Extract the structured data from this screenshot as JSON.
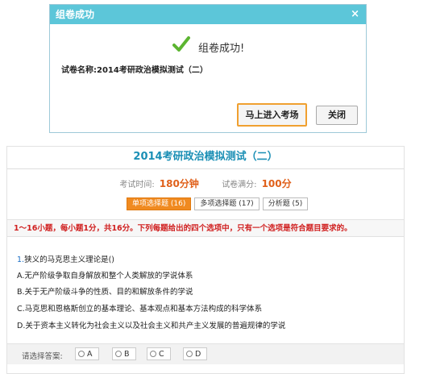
{
  "dialog": {
    "title": "组卷成功",
    "close_symbol": "×",
    "success_message": "组卷成功!",
    "success_icon": "checkmark-icon",
    "paper_label": "试卷名称:",
    "paper_name": "2014考研政治模拟测试（二）",
    "enter_button": "马上进入考场",
    "close_button": "关闭",
    "colors": {
      "header": "#5cc6d9",
      "check": "#5cb531",
      "enter_border": "#f0a030"
    }
  },
  "exam": {
    "title": "2014考研政治模拟测试（二）",
    "time_label": "考试时间:",
    "time_value": "180分钟",
    "score_label": "试卷满分:",
    "score_value": "100分",
    "tabs": [
      {
        "label": "单项选择题 (16)",
        "active": true
      },
      {
        "label": "多项选择题 (17)",
        "active": false
      },
      {
        "label": "分析题 (5)",
        "active": false
      }
    ],
    "instructions": "1～16小题，每小题1分，共16分。下列每题给出的四个选项中，只有一个选项是符合题目要求的。",
    "question": {
      "number": "1.",
      "text": "狭义的马克思主义理论是()",
      "options": [
        "A.无产阶级争取自身解放和整个人类解放的学说体系",
        "B.关于无产阶级斗争的性质、目的和解放条件的学说",
        "C.马克思和恩格斯创立的基本理论、基本观点和基本方法构成的科学体系",
        "D.关于资本主义转化为社会主义以及社会主义和共产主义发展的普遍规律的学说"
      ]
    },
    "answer_label": "请选择答案:",
    "choices": [
      "A",
      "B",
      "C",
      "D"
    ],
    "colors": {
      "title": "#1b8fb5",
      "accent": "#f08a20",
      "warning": "#d02020"
    }
  }
}
